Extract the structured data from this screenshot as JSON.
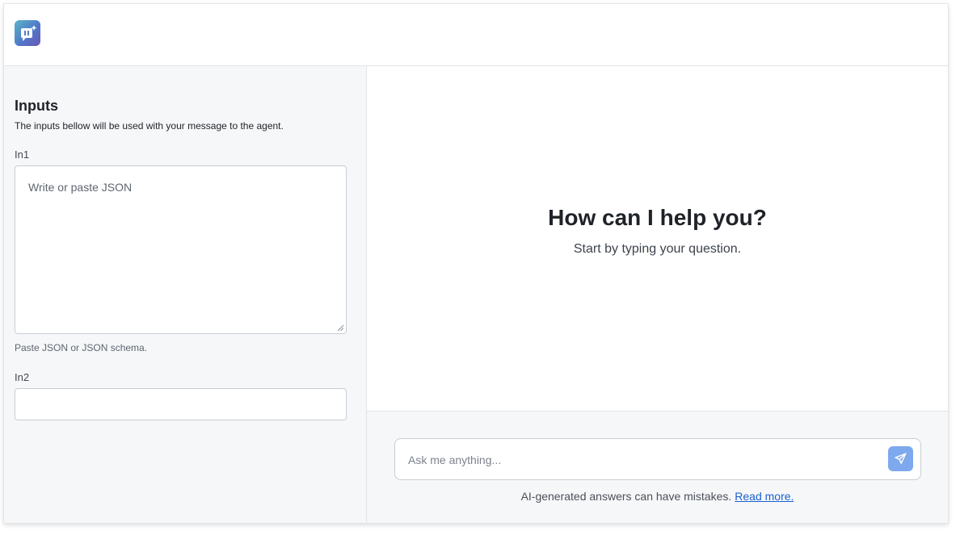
{
  "header": {
    "logo_icon": "chat-agent-logo-icon"
  },
  "inputs_panel": {
    "title": "Inputs",
    "description": "The inputs bellow will be used with your message to the agent.",
    "in1": {
      "label": "In1",
      "placeholder": "Write or paste JSON",
      "value": "",
      "helper": "Paste JSON or JSON schema."
    },
    "in2": {
      "label": "In2",
      "value": ""
    }
  },
  "chat": {
    "heading": "How can I help you?",
    "subheading": "Start by typing your question.",
    "input_placeholder": "Ask me anything...",
    "send_icon": "send-icon",
    "disclaimer": "AI-generated answers can have mistakes.",
    "read_more": "Read more."
  },
  "colors": {
    "accent": "#7fa9ee",
    "link": "#1a5fd0",
    "panel_bg": "#f6f7f9"
  }
}
